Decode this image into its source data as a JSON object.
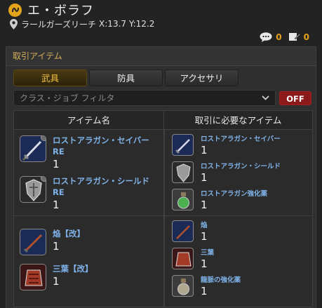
{
  "header": {
    "title": "エ・ボラフ",
    "location": "ラールガーズリーチ",
    "coords": "X:13.7 Y:12.2",
    "comment_count": "0",
    "edit_count": "0"
  },
  "panel": {
    "title": "取引アイテム",
    "tabs": [
      {
        "label": "武具",
        "active": true
      },
      {
        "label": "防具",
        "active": false
      },
      {
        "label": "アクセサリ",
        "active": false
      }
    ],
    "filter_placeholder": "クラス・ジョブ フィルタ",
    "off_label": "OFF"
  },
  "table": {
    "col_item": "アイテム名",
    "col_required": "取引に必要なアイテム",
    "rows": [
      {
        "left": [
          {
            "name_line1": "ロストアラガン・セイバー",
            "name_line2": "RE",
            "qty": "1",
            "icon": "sword-icon"
          },
          {
            "name_line1": "ロストアラガン・シールド",
            "name_line2": "RE",
            "qty": "1",
            "icon": "shield-icon"
          }
        ],
        "right": [
          {
            "name": "ロストアラガン・セイバー",
            "qty": "1",
            "icon": "sword-icon"
          },
          {
            "name": "ロストアラガン・シールド",
            "qty": "1",
            "icon": "shield-icon"
          },
          {
            "name": "ロストアラガン強化薬",
            "qty": "1",
            "icon": "potion-icon"
          }
        ]
      },
      {
        "left": [
          {
            "name_line1": "焔【改】",
            "qty": "1",
            "icon": "sword-icon"
          },
          {
            "name_line1": "三葉【改】",
            "qty": "1",
            "icon": "armor-icon"
          }
        ],
        "right": [
          {
            "name": "焔",
            "qty": "1",
            "icon": "sword-icon"
          },
          {
            "name": "三葉",
            "qty": "1",
            "icon": "armor-icon"
          },
          {
            "name": "龍脈の強化薬",
            "qty": "1",
            "icon": "potion-icon"
          }
        ]
      }
    ]
  },
  "colors": {
    "accent": "#e3a41c",
    "link": "#7fb2e8",
    "off": "#8c1a1a"
  }
}
